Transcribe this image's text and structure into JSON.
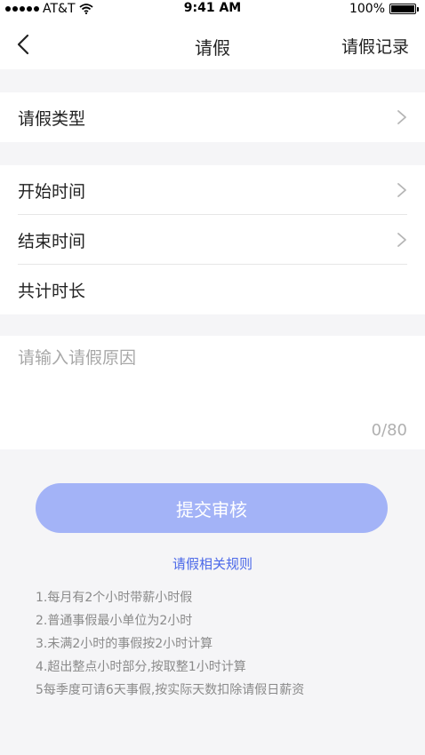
{
  "status_bar": {
    "carrier": "AT&T",
    "time": "9:41 AM",
    "battery": "100%",
    "battery_level": 1.0
  },
  "nav": {
    "title": "请假",
    "right_action": "请假记录"
  },
  "form": {
    "leave_type_label": "请假类型",
    "start_time_label": "开始时间",
    "end_time_label": "结束时间",
    "total_duration_label": "共计时长",
    "reason_placeholder": "请输入请假原因",
    "reason_value": "",
    "reason_count": "0/80"
  },
  "submit_label": "提交审核",
  "rules": {
    "title": "请假相关规则",
    "items": [
      "1.每月有2个小时带薪小时假",
      "2.普通事假最小单位为2小时",
      "3.未满2小时的事假按2小时计算",
      "4.超出整点小时部分,按取整1小时计算",
      "5每季度可请6天事假,按实际天数扣除请假日薪资"
    ]
  },
  "colors": {
    "accent": "#4b68e8",
    "button": "#a3b3f7",
    "background": "#f5f5f7"
  }
}
